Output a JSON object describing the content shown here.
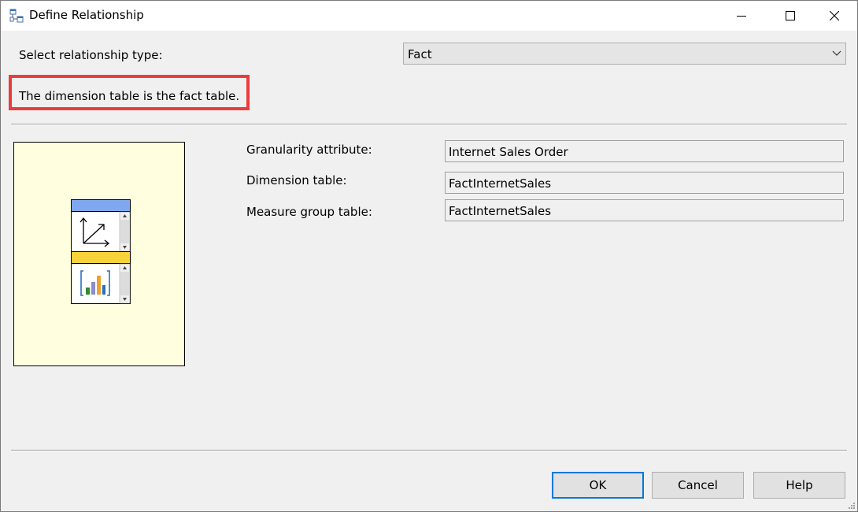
{
  "window": {
    "title": "Define Relationship",
    "icon": "relationship-icon"
  },
  "relationship": {
    "type_label": "Select relationship type:",
    "type_value": "Fact",
    "description": "The dimension table is the fact table."
  },
  "fields": {
    "granularity_label": "Granularity attribute:",
    "granularity_value": "Internet Sales Order",
    "dimension_label": "Dimension table:",
    "dimension_value": "FactInternetSales",
    "measure_group_label": "Measure group table:",
    "measure_group_value": "FactInternetSales"
  },
  "buttons": {
    "ok": "OK",
    "cancel": "Cancel",
    "help": "Help"
  },
  "colors": {
    "highlight": "#ee3b3b",
    "diagram_bg": "#ffffe0",
    "dimension_header": "#7fa8f0",
    "measure_header": "#f8d23a",
    "default_button_border": "#0078d7"
  }
}
